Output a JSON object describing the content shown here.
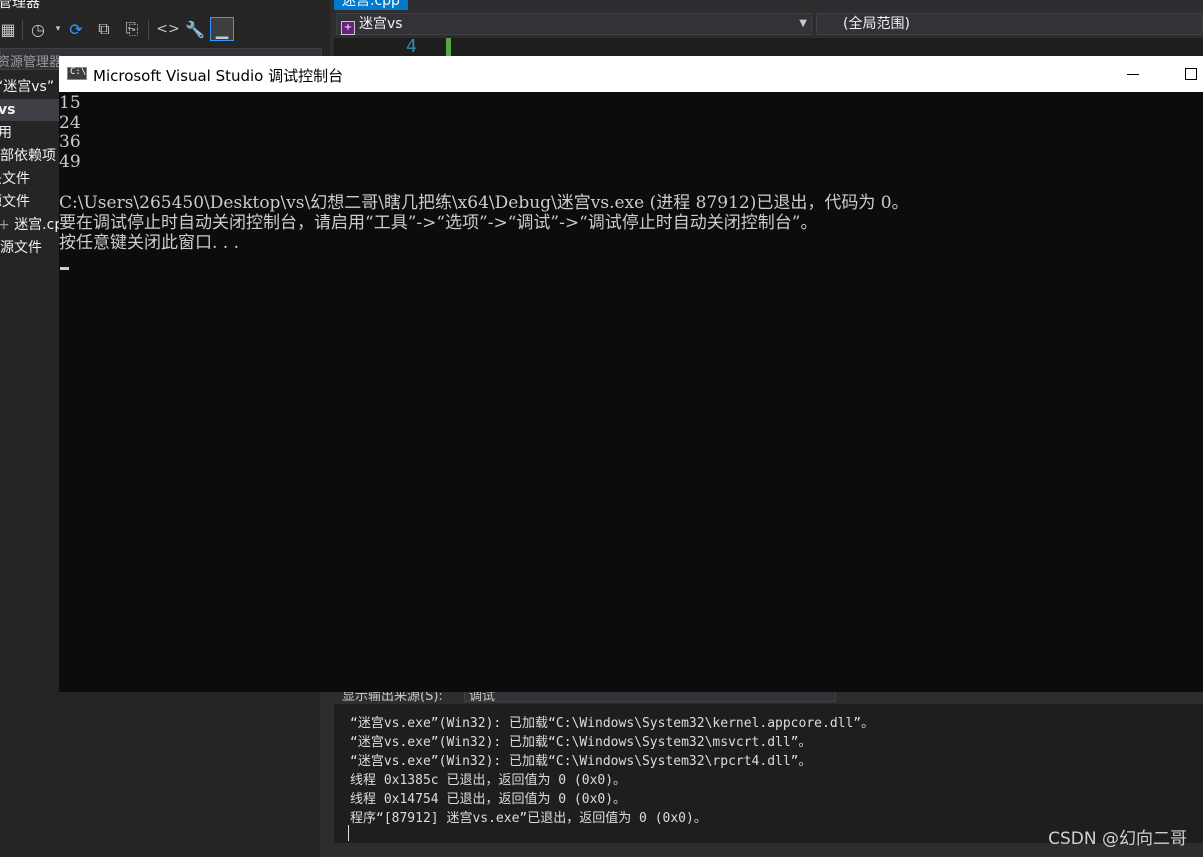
{
  "solution_explorer": {
    "title": "管理器",
    "search_placeholder": "资源管理器(Ctrl+;)",
    "items": [
      "“迷宫vs”",
      "vs",
      "引用",
      "外部依赖项",
      "头文件",
      "源文件",
      "迷宫.cpp",
      "资源文件"
    ]
  },
  "editor": {
    "tab_label": "迷宫.cpp",
    "project_combo": "迷宫vs",
    "scope_combo": "(全局范围)",
    "line_number": "4"
  },
  "console": {
    "title": "Microsoft Visual Studio 调试控制台",
    "icon_text": "C:\\",
    "lines": [
      "15",
      "24",
      "36",
      "49",
      "",
      "C:\\Users\\265450\\Desktop\\vs\\幻想二哥\\瞎几把练\\x64\\Debug\\迷宫vs.exe (进程 87912)已退出，代码为 0。",
      "要在调试停止时自动关闭控制台，请启用“工具”->“选项”->“调试”->“调试停止时自动关闭控制台”。",
      "按任意键关闭此窗口. . ."
    ]
  },
  "output": {
    "source_label": "显示输出来源(S):",
    "source_value": "调试",
    "lines": [
      "“迷宫vs.exe”(Win32): 已加载“C:\\Windows\\System32\\kernel.appcore.dll”。",
      "“迷宫vs.exe”(Win32): 已加载“C:\\Windows\\System32\\msvcrt.dll”。",
      "“迷宫vs.exe”(Win32): 已加载“C:\\Windows\\System32\\rpcrt4.dll”。",
      "线程 0x1385c 已退出，返回值为 0 (0x0)。",
      "线程 0x14754 已退出，返回值为 0 (0x0)。",
      "程序“[87912] 迷宫vs.exe”已退出，返回值为 0 (0x0)。"
    ]
  },
  "watermark": "CSDN @幻向二哥",
  "colors": {
    "vs_background": "#2d2d30",
    "console_background": "#0c0c0c",
    "console_text": "#cccccc",
    "accent": "#007acc"
  }
}
